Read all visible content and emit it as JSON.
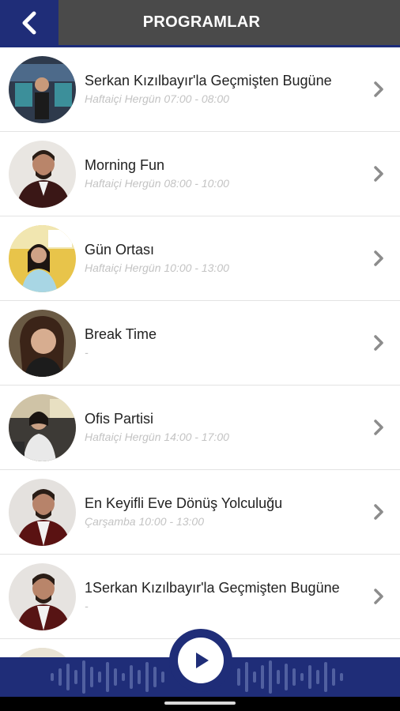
{
  "header": {
    "title": "PROGRAMLAR",
    "back_icon": "chevron-left-icon"
  },
  "programs": [
    {
      "name": "Serkan Kızılbayır'la Geçmişten Bugüne",
      "schedule": "Haftaiçi Hergün 07:00 - 08:00"
    },
    {
      "name": "Morning Fun",
      "schedule": "Haftaiçi Hergün 08:00 - 10:00"
    },
    {
      "name": "Gün Ortası",
      "schedule": "Haftaiçi Hergün 10:00 - 13:00"
    },
    {
      "name": "Break Time",
      "schedule": "-"
    },
    {
      "name": "Ofis Partisi",
      "schedule": "Haftaiçi Hergün 14:00 - 17:00"
    },
    {
      "name": "En Keyifli Eve Dönüş Yolculuğu",
      "schedule": "Çarşamba 10:00 - 13:00"
    },
    {
      "name": "1Serkan Kızılbayır'la Geçmişten Bugüne",
      "schedule": "-"
    }
  ],
  "player": {
    "play_icon": "play-icon"
  },
  "colors": {
    "brand_blue": "#1f2d78",
    "header_gray": "#4a4a4a",
    "schedule_gray": "#c3c3c3"
  }
}
